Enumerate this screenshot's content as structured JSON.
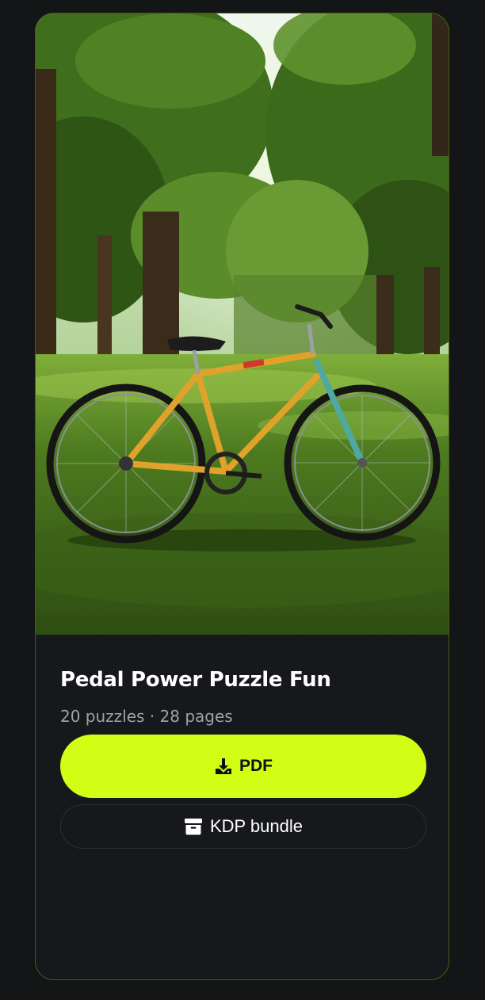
{
  "card": {
    "title": "Pedal Power Puzzle Fun",
    "meta": "20 puzzles · 28 pages",
    "hero_icon": "bicycle-in-park-photo"
  },
  "actions": {
    "pdf_label": "PDF",
    "pdf_icon": "download-icon",
    "kdp_label": "KDP bundle",
    "kdp_icon": "archive-box-icon"
  },
  "colors": {
    "accent": "#d2fe16",
    "background": "#141516",
    "card": "#17181b",
    "card_border": "#4d5a12",
    "muted_text": "#9ea1a6"
  }
}
